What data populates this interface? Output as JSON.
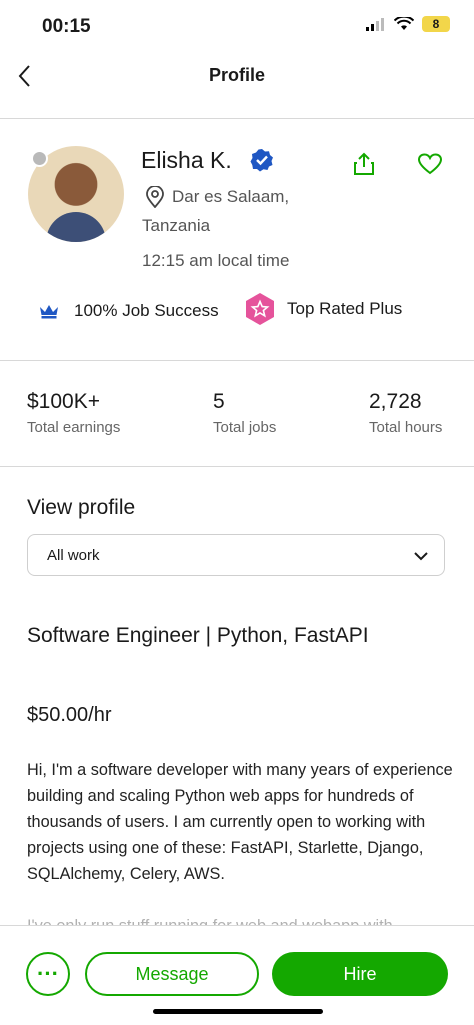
{
  "status_bar": {
    "time": "00:15",
    "battery": "8"
  },
  "header": {
    "title": "Profile"
  },
  "profile": {
    "name": "Elisha K.",
    "location_city": "Dar es Salaam,",
    "location_country": "Tanzania",
    "local_time": "12:15 am local time",
    "job_success": "100% Job Success",
    "badge": "Top Rated Plus"
  },
  "stats": [
    {
      "value": "$100K+",
      "label": "Total earnings"
    },
    {
      "value": "5",
      "label": "Total jobs"
    },
    {
      "value": "2,728",
      "label": "Total hours"
    }
  ],
  "view_profile": {
    "heading": "View profile",
    "selected": "All work"
  },
  "job": {
    "headline": "Software Engineer | Python, FastAPI",
    "rate": "$50.00/hr",
    "bio": "Hi, I'm a software developer with many years of experience building and scaling Python web apps for hundreds of thousands of users. I am currently open to working with projects using one of these: FastAPI, Starlette, Django, SQLAlchemy, Celery, AWS.",
    "bio_more": "I've only run stuff running for web and webapp with..."
  },
  "actions": {
    "more": "···",
    "message": "Message",
    "hire": "Hire"
  },
  "colors": {
    "accent": "#14a800",
    "verified": "#1f57c3",
    "badge": "#e5539b"
  }
}
